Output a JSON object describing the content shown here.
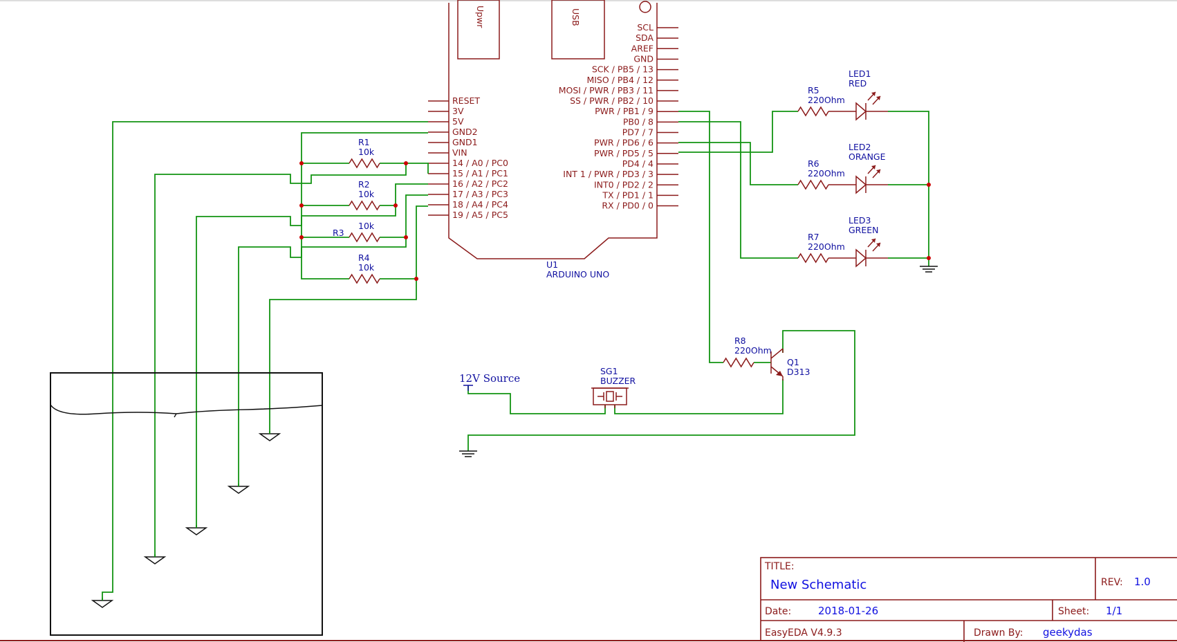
{
  "arduino": {
    "ref": "U1",
    "name": "ARDUINO UNO",
    "header_labels": [
      "Upwr",
      "USB"
    ],
    "left_pins": [
      "RESET",
      "3V",
      "5V",
      "GND2",
      "GND1",
      "VIN",
      "14 / A0 / PC0",
      "15 / A1 / PC1",
      "16 / A2 / PC2",
      "17 / A3 / PC3",
      "18 / A4 / PC4",
      "19 / A5 / PC5"
    ],
    "right_pins": [
      "SCL",
      "SDA",
      "AREF",
      "GND",
      "SCK / PB5 / 13",
      "MISO / PB4 / 12",
      "MOSI / PWR / PB3 / 11",
      "SS / PWR / PB2 / 10",
      "PWR / PB1 / 9",
      "PB0 / 8",
      "PD7 / 7",
      "PWR / PD6 / 6",
      "PWR / PD5 / 5",
      "PD4 / 4",
      "INT 1 / PWR / PD3 / 3",
      "INT0 / PD2 / 2",
      "TX / PD1 / 1",
      "RX / PD0 / 0"
    ]
  },
  "resistors": [
    {
      "ref": "R1",
      "value": "10k"
    },
    {
      "ref": "R2",
      "value": "10k"
    },
    {
      "ref": "R3",
      "value": "10k"
    },
    {
      "ref": "R4",
      "value": "10k"
    },
    {
      "ref": "R5",
      "value": "220Ohm"
    },
    {
      "ref": "R6",
      "value": "220Ohm"
    },
    {
      "ref": "R7",
      "value": "220Ohm"
    },
    {
      "ref": "R8",
      "value": "220Ohm"
    }
  ],
  "leds": [
    {
      "ref": "LED1",
      "color": "RED"
    },
    {
      "ref": "LED2",
      "color": "ORANGE"
    },
    {
      "ref": "LED3",
      "color": "GREEN"
    }
  ],
  "transistor": {
    "ref": "Q1",
    "value": "D313"
  },
  "buzzer": {
    "ref": "SG1",
    "value": "BUZZER"
  },
  "source": {
    "label": "12V Source"
  },
  "title_block": {
    "title_label": "TITLE:",
    "title": "New Schematic",
    "rev_label": "REV:",
    "rev": "1.0",
    "date_label": "Date:",
    "date": "2018-01-26",
    "sheet_label": "Sheet:",
    "sheet": "1/1",
    "tool": "EasyEDA V4.9.3",
    "drawn_by_label": "Drawn By:",
    "drawn_by": "geekydas"
  },
  "colors": {
    "part": "#8b1a1a",
    "wire": "#129412",
    "label": "#1010a0",
    "value_text": "#1010e0",
    "junction": "#cc0000"
  }
}
